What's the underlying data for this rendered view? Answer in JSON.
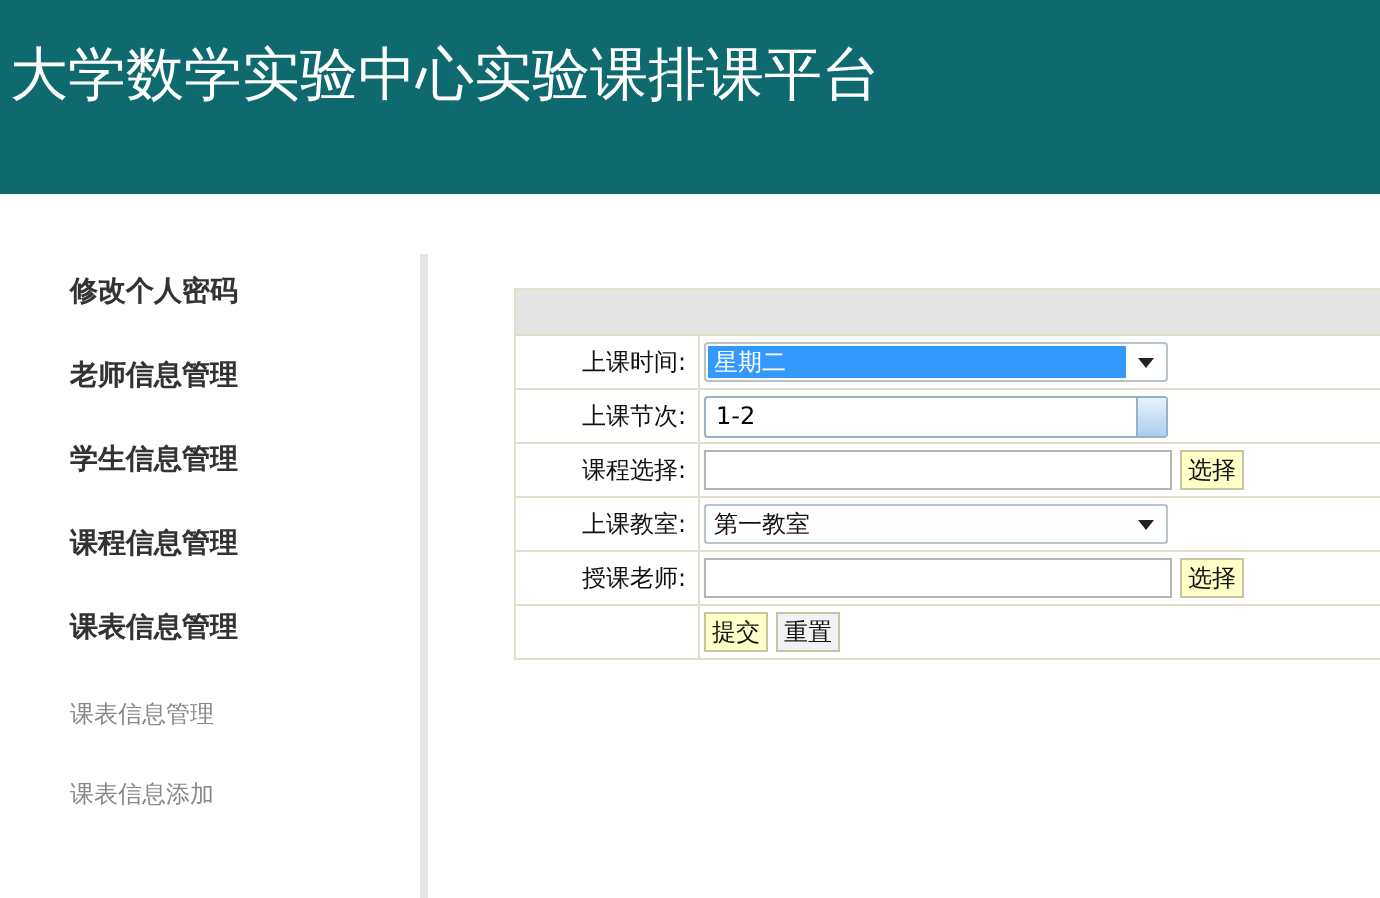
{
  "header": {
    "title": "大学数学实验中心实验课排课平台"
  },
  "sidebar": {
    "items": [
      {
        "label": "修改个人密码",
        "kind": "main"
      },
      {
        "label": "老师信息管理",
        "kind": "main"
      },
      {
        "label": "学生信息管理",
        "kind": "main"
      },
      {
        "label": "课程信息管理",
        "kind": "main"
      },
      {
        "label": "课表信息管理",
        "kind": "main"
      },
      {
        "label": "课表信息管理",
        "kind": "sub"
      },
      {
        "label": "课表信息添加",
        "kind": "sub"
      }
    ]
  },
  "form": {
    "rows": [
      {
        "kind": "select",
        "label": "上课时间:",
        "value": "星期二",
        "highlighted": true
      },
      {
        "kind": "combo",
        "label": "上课节次:",
        "value": "1-2"
      },
      {
        "kind": "picker",
        "label": "课程选择:",
        "button": "选择"
      },
      {
        "kind": "select",
        "label": "上课教室:",
        "value": "第一教室",
        "highlighted": false
      },
      {
        "kind": "picker",
        "label": "授课老师:",
        "button": "选择"
      },
      {
        "kind": "actions",
        "buttons": [
          {
            "label": "提交",
            "kind": "primary"
          },
          {
            "label": "重置",
            "kind": "plain"
          }
        ]
      }
    ]
  }
}
